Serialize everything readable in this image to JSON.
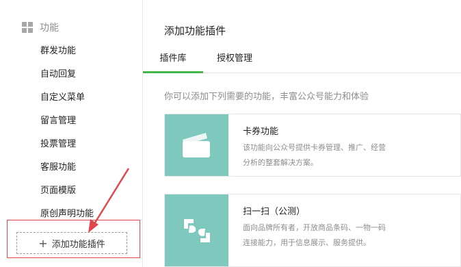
{
  "sidebar": {
    "section_title": "功能",
    "items": [
      {
        "label": "群发功能"
      },
      {
        "label": "自动回复"
      },
      {
        "label": "自定义菜单"
      },
      {
        "label": "留言管理"
      },
      {
        "label": "投票管理"
      },
      {
        "label": "客服功能"
      },
      {
        "label": "页面模版"
      },
      {
        "label": "原创声明功能"
      }
    ],
    "add_plugin_label": "添加功能插件"
  },
  "main": {
    "title": "添加功能插件",
    "tabs": [
      {
        "label": "插件库",
        "active": true
      },
      {
        "label": "授权管理",
        "active": false
      }
    ],
    "hint": "你可以添加下列需要的功能，丰富公众号能力和体验",
    "plugins": [
      {
        "title": "卡券功能",
        "desc_line1": "该功能向公众号提供卡券管理、推广、经营",
        "desc_line2": "分析的整套解决方案。",
        "icon": "card-icon"
      },
      {
        "title": "扫一扫（公测）",
        "desc_line1": "面向品牌所有者，开放商品条码、一物一码",
        "desc_line2": "连接能力，用于信息展示、服务提供。",
        "icon": "scan-icon"
      }
    ]
  },
  "colors": {
    "accent_green": "#44b549",
    "plugin_icon_bg": "#7ec8be",
    "annotation_red": "#e0484e"
  }
}
